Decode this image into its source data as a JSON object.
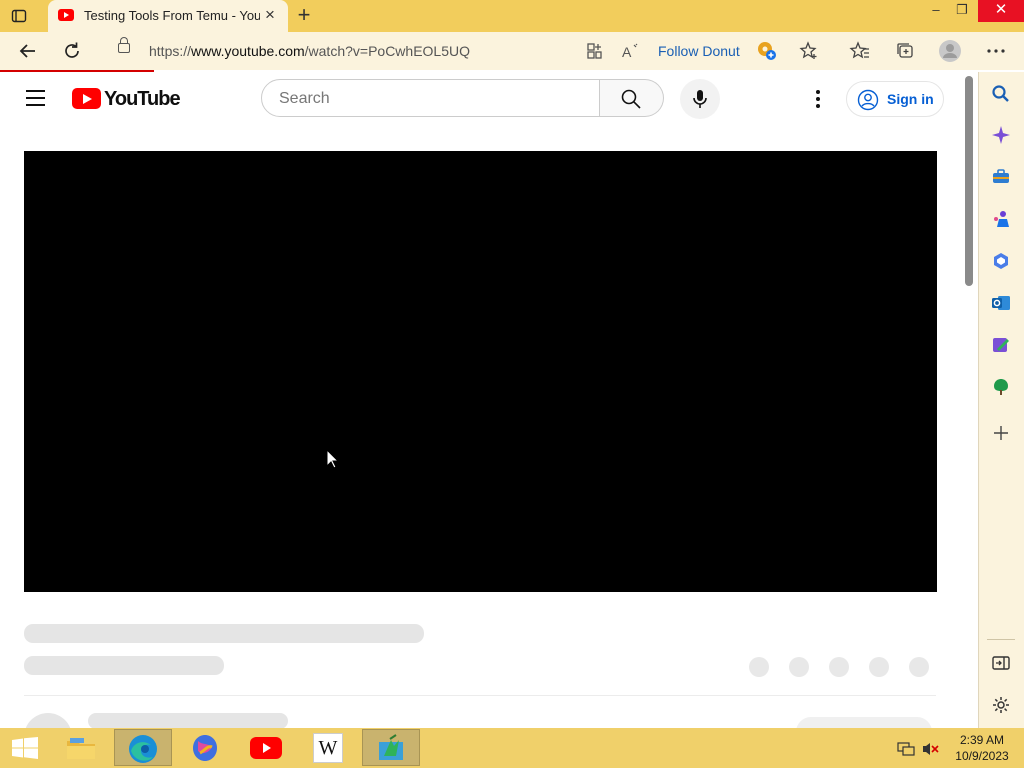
{
  "browser": {
    "tab_title": "Testing Tools From Temu - YouTube",
    "tab_close_icon": "close-icon",
    "new_tab_icon": "plus-icon",
    "window_controls": {
      "minimize": "–",
      "restore": "❐",
      "close": "✕"
    },
    "url_prefix": "https://",
    "url_host": "www.youtube.com",
    "url_path": "/watch?v=PoCwhEOL5UQ",
    "follow_label": "Follow Donut",
    "toolbar_icons": [
      "back-arrow-icon",
      "refresh-icon",
      "lock-icon",
      "app-available-icon",
      "read-aloud-icon",
      "donut-extension-icon",
      "add-favorite-icon",
      "favorites-icon",
      "collections-icon",
      "profile-icon",
      "more-icon"
    ]
  },
  "youtube": {
    "logo_text": "YouTube",
    "search_placeholder": "Search",
    "sign_in_label": "Sign in"
  },
  "sidebar": {
    "icons": [
      "search-icon",
      "copilot-icon",
      "tools-icon",
      "games-icon",
      "microsoft-365-icon",
      "outlook-icon",
      "drop-icon",
      "tree-icon",
      "add-icon",
      "hide-sidebar-icon",
      "settings-icon"
    ]
  },
  "taskbar": {
    "apps": [
      "start-icon",
      "file-explorer-icon",
      "edge-icon",
      "copilot-icon",
      "youtube-icon",
      "wikipedia-icon",
      "recorder-icon"
    ],
    "wikipedia_glyph": "W",
    "time": "2:39 AM",
    "date": "10/9/2023"
  },
  "colors": {
    "titlebar": "#f2cd5c",
    "toolbar": "#fbf3dd",
    "youtube_red": "#ff0000",
    "link_blue": "#065fd4",
    "taskbar": "#f0d06a"
  }
}
